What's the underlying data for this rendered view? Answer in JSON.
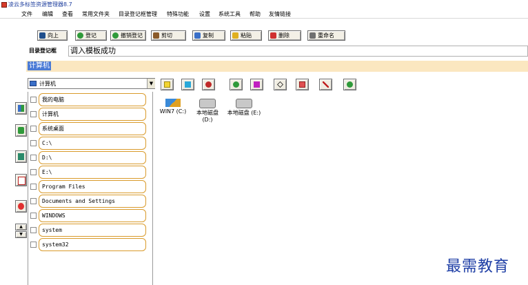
{
  "window": {
    "title": "凌云多标签资源管理器8.7"
  },
  "menu": [
    "文件",
    "编辑",
    "查看",
    "常用文件夹",
    "目录登记框管理",
    "特殊功能",
    "设置",
    "系统工具",
    "帮助",
    "友情链接"
  ],
  "toolbar": {
    "up": "向上",
    "register": "登记",
    "unregister": "撤销登记",
    "cut": "剪切",
    "copy": "复制",
    "paste": "粘贴",
    "delete": "删除",
    "rename": "重命名"
  },
  "registry": {
    "label": "目录登记框",
    "value": "调入模板成功"
  },
  "band": {
    "selected": "计算机"
  },
  "location": {
    "value": "计算机"
  },
  "left_items": [
    "我的电脑",
    "计算机",
    "系统桌面",
    "C:\\",
    "D:\\",
    "E:\\",
    "Program Files",
    "Documents and Settings",
    "WINDOWS",
    "system",
    "system32"
  ],
  "drives": [
    {
      "label": "WIN7 (C:)"
    },
    {
      "label": "本地磁盘\n(D:)"
    },
    {
      "label": "本地磁盘 (E:)"
    }
  ],
  "watermark": "最需教育",
  "icons": {
    "toolbar": [
      "up-arrow-icon",
      "register-icon",
      "unregister-icon",
      "scissors-icon",
      "copy-icon",
      "paste-icon",
      "delete-x-icon",
      "rename-icon"
    ],
    "icon_toolbar": [
      "new-folder-icon",
      "add-icon",
      "favorite-icon",
      "check-icon",
      "stop-icon",
      "diamond-icon",
      "red-square-icon",
      "line-icon",
      "refresh-icon"
    ],
    "strip": [
      "forward-icon",
      "green-phone-icon",
      "pin-icon",
      "calendar-icon",
      "red-stop-icon"
    ]
  }
}
